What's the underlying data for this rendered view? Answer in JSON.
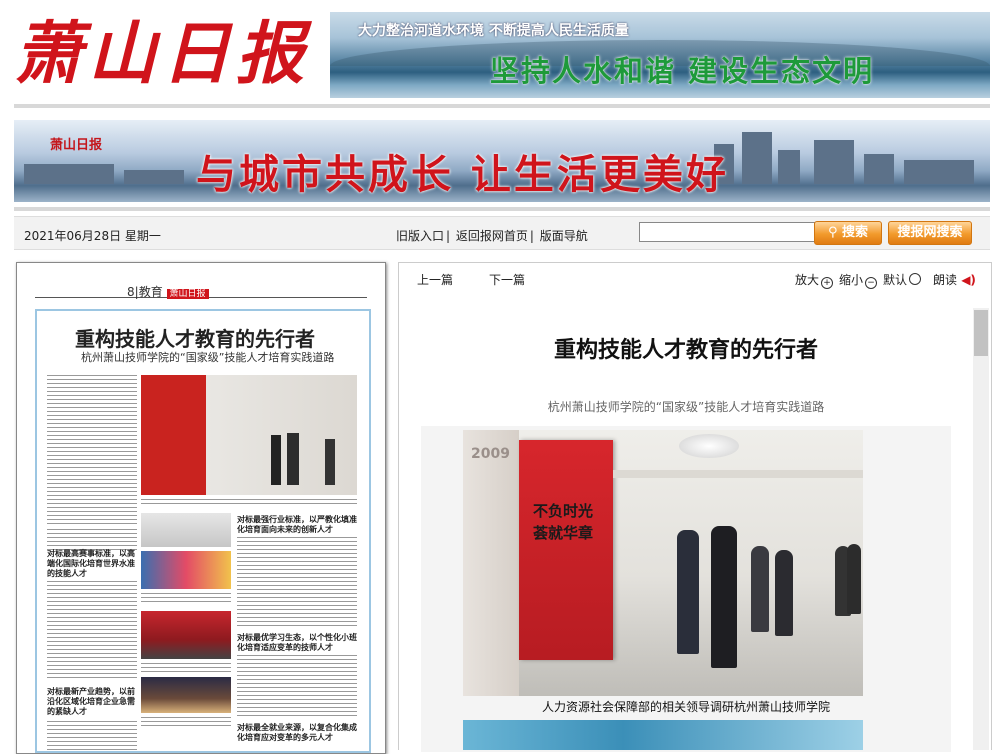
{
  "header": {
    "logo_text": "萧山日报",
    "top_banner_line1": "大力整治河道水环境    不断提高人民生活质量",
    "top_banner_line2": "坚持人水和谐    建设生态文明",
    "second_banner_logo": "萧山日报",
    "second_banner_slogan": "与城市共成长    让生活更美好"
  },
  "toolbar": {
    "date": "2021年06月28日 星期一",
    "nav": [
      "旧版入口",
      "返回报网首页",
      "版面导航"
    ],
    "search_value": "",
    "search_button": "搜索",
    "site_search_button": "搜报网搜索"
  },
  "left_page": {
    "page_number": "8",
    "section": "教育",
    "paper_tag": "萧山日报",
    "headline": "重构技能人才教育的先行者",
    "subhead": "杭州萧山技师学院的“国家级”技能人才培育实践道路",
    "col_heads": [
      "对标最高赛事标准，以高端化国际化培育世界水准的技能人才",
      "对标最强行业标准，以严教化填准化培育面向未来的创新人才",
      "对标最优学习生态，以个性化小班化培育适应变革的技师人才",
      "对标最新产业趋势，以前沿化区域化培育企业急需的紧缺人才",
      "对标最全就业来源，以复合化集成化培育应对变革的多元人才"
    ]
  },
  "article_toolbar": {
    "prev": "上一篇",
    "next": "下一篇",
    "zoom_in": "放大",
    "zoom_out": "缩小",
    "reset": "默认",
    "read": "朗读"
  },
  "article": {
    "title": "重构技能人才教育的先行者",
    "subtitle": "杭州萧山技师学院的“国家级”技能人才培育实践道路",
    "photo_caption": "人力资源社会保障部的相关领导调研杭州萧山技师学院",
    "photo_sign_text": "不负时光 荟就华章",
    "photo_sign_year": "2009"
  },
  "colors": {
    "brand_red": "#d0141b",
    "banner_green": "#1e9a3a",
    "button_orange": "#f29a2c",
    "frame_blue": "#9cc6e2"
  }
}
